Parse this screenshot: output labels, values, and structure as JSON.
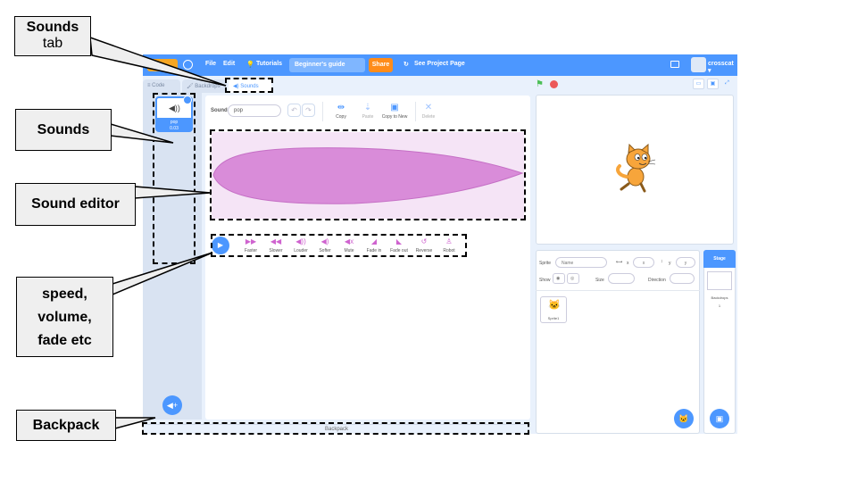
{
  "annotations": {
    "sounds_tab": {
      "line1": "Sounds",
      "line2": "tab"
    },
    "sounds": "Sounds",
    "sound_editor": "Sound editor",
    "effects": {
      "line1": "speed,",
      "line2": "volume,",
      "line3": "fade etc"
    },
    "backpack": "Backpack"
  },
  "menubar": {
    "file": "File",
    "edit": "Edit",
    "tutorials": "Tutorials",
    "project_title": "Beginner's guide",
    "share": "Share",
    "see_project": "See Project Page",
    "username": "crosscat ▾"
  },
  "tabs": {
    "code": "Code",
    "backdrops": "Backdrops",
    "sounds": "Sounds"
  },
  "sound_item": {
    "name": "pop",
    "duration": "0.03"
  },
  "editor": {
    "sound_label": "Sound",
    "sound_name": "pop",
    "undo_icon": "↶",
    "redo_icon": "↷",
    "tools": [
      {
        "icon": "scissors-icon",
        "glyph": "⇹",
        "label": "Copy"
      },
      {
        "icon": "paste-icon",
        "glyph": "⇣",
        "label": "Paste"
      },
      {
        "icon": "copy-new-icon",
        "glyph": "▣",
        "label": "Copy to New"
      },
      {
        "icon": "delete-icon",
        "glyph": "✕",
        "label": "Delete"
      }
    ]
  },
  "effects": [
    {
      "icon": "faster-icon",
      "glyph": "▶▶",
      "label": "Faster"
    },
    {
      "icon": "slower-icon",
      "glyph": "◀◀",
      "label": "Slower"
    },
    {
      "icon": "louder-icon",
      "glyph": "◀))",
      "label": "Louder"
    },
    {
      "icon": "softer-icon",
      "glyph": "◀)",
      "label": "Softer"
    },
    {
      "icon": "mute-icon",
      "glyph": "◀x",
      "label": "Mute"
    },
    {
      "icon": "fade-in-icon",
      "glyph": "◢",
      "label": "Fade in"
    },
    {
      "icon": "fade-out-icon",
      "glyph": "◣",
      "label": "Fade out"
    },
    {
      "icon": "reverse-icon",
      "glyph": "↺",
      "label": "Reverse"
    },
    {
      "icon": "robot-icon",
      "glyph": "♙",
      "label": "Robot"
    }
  ],
  "backpack_label": "Backpack",
  "sprite_info": {
    "sprite_label": "Sprite",
    "sprite_name": "Name",
    "x_label": "x",
    "x_value": "x",
    "y_label": "y",
    "y_value": "y",
    "show_label": "Show",
    "size_label": "Size",
    "direction_label": "Direction"
  },
  "sprite_thumb": "Sprite1",
  "stage_pane": {
    "title": "Stage",
    "backdrops_label": "Backdrops",
    "backdrops_count": "1"
  },
  "colors": {
    "accent": "#4c97ff",
    "sound_wave": "#d98cd9",
    "wave_bg": "#f5e4f6",
    "share": "#ff8c1a"
  }
}
